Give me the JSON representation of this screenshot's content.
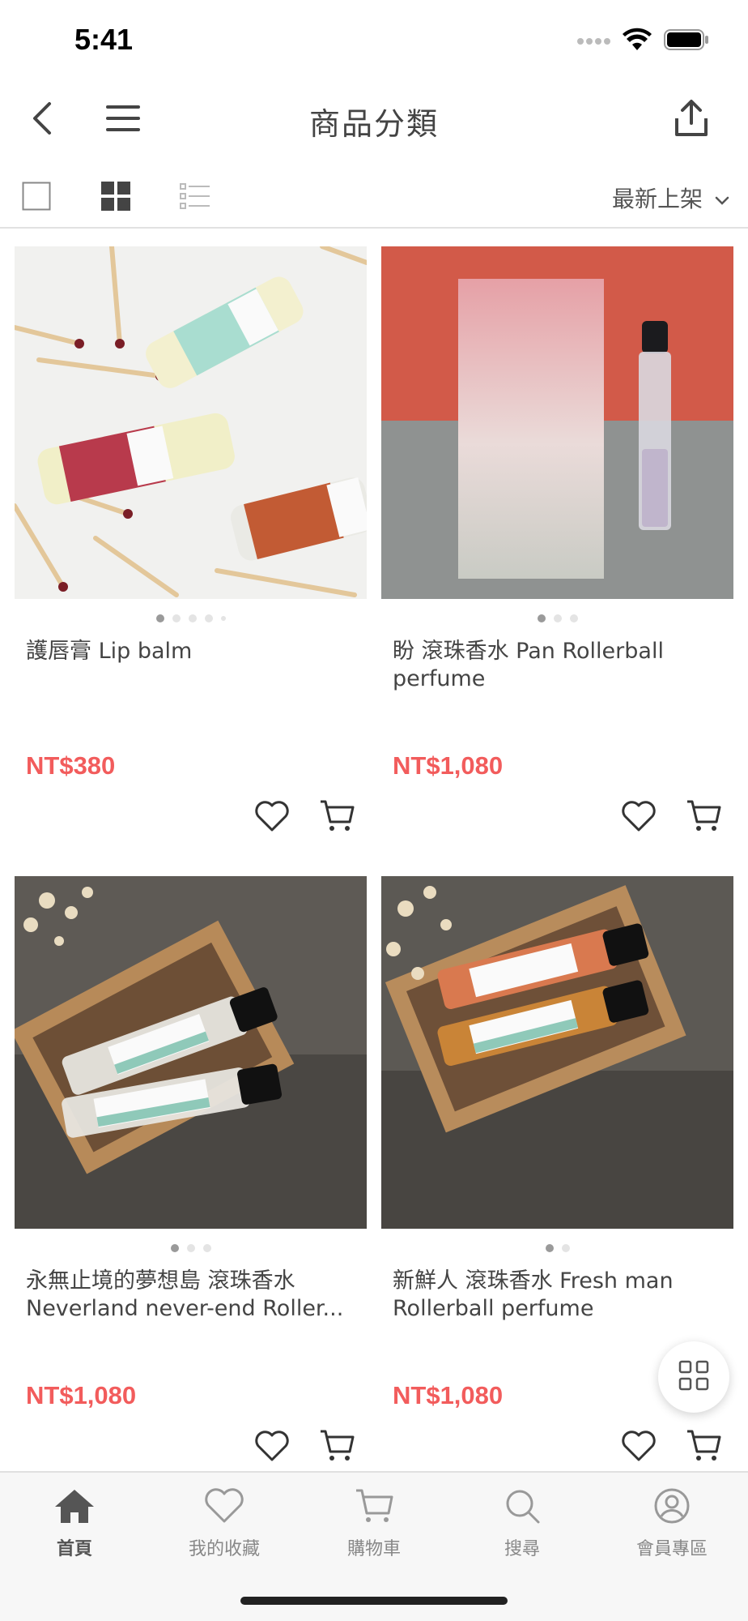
{
  "status_bar": {
    "time": "5:41"
  },
  "nav": {
    "title": "商品分類"
  },
  "toolbar": {
    "sort_label": "最新上架"
  },
  "products": [
    {
      "name": "護唇膏 Lip balm",
      "price": "NT$380",
      "image_dots": 5,
      "active_dot": 0
    },
    {
      "name": "盼 滾珠香水 Pan Rollerball perfume",
      "price": "NT$1,080",
      "image_dots": 3,
      "active_dot": 0
    },
    {
      "name": "永無止境的夢想島 滾珠香水 Neverland never-end Roller...",
      "price": "NT$1,080",
      "image_dots": 3,
      "active_dot": 0
    },
    {
      "name": "新鮮人 滾珠香水 Fresh man Rollerball perfume",
      "price": "NT$1,080",
      "image_dots": 2,
      "active_dot": 0
    }
  ],
  "tab_bar": {
    "tabs": [
      {
        "label": "首頁",
        "icon": "home-icon",
        "active": true
      },
      {
        "label": "我的收藏",
        "icon": "heart-icon",
        "active": false
      },
      {
        "label": "購物車",
        "icon": "cart-icon",
        "active": false
      },
      {
        "label": "搜尋",
        "icon": "search-icon",
        "active": false
      },
      {
        "label": "會員專區",
        "icon": "user-icon",
        "active": false
      }
    ]
  },
  "colors": {
    "price": "#f25c5c",
    "icon": "#333333",
    "tab_inactive": "#888888"
  }
}
